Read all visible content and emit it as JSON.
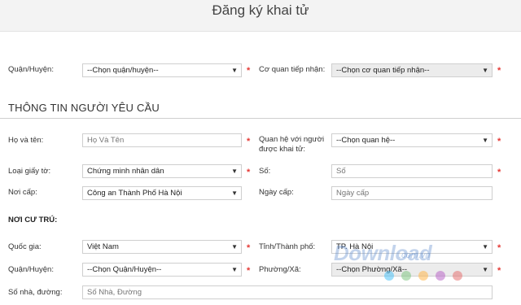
{
  "page": {
    "title": "Đăng ký khai tử"
  },
  "top": {
    "district_label": "Quận/Huyện:",
    "district_value": "--Chọn quận/huyện--",
    "agency_label": "Cơ quan tiếp nhận:",
    "agency_value": "--Chọn cơ quan tiếp nhận--"
  },
  "section": {
    "title": "THÔNG TIN NGƯỜI YÊU CẦU"
  },
  "requester": {
    "name_label": "Họ và tên:",
    "name_placeholder": "Họ Và Tên",
    "relation_label_1": "Quan hệ với người",
    "relation_label_2": "được khai tử:",
    "relation_value": "--Chọn quan hệ--",
    "doc_type_label": "Loại giấy tờ:",
    "doc_type_value": "Chứng minh nhân dân",
    "number_label": "Số:",
    "number_placeholder": "Số",
    "issued_by_label": "Nơi cấp:",
    "issued_by_value": "Công an Thành Phố Hà Nội",
    "issue_date_label": "Ngày cấp:",
    "issue_date_placeholder": "Ngày cấp"
  },
  "residence": {
    "heading": "NƠI CƯ TRÚ:",
    "country_label": "Quốc gia:",
    "country_value": "Việt Nam",
    "province_label": "Tỉnh/Thành phố:",
    "province_value": "TP. Hà Nội",
    "district_label": "Quận/Huyện:",
    "district_value": "--Chọn Quận/Huyện--",
    "ward_label": "Phường/Xã:",
    "ward_value": "--Chọn Phường/Xã--",
    "address_label": "Số nhà, đường:",
    "address_placeholder": "Số Nhà, Đường"
  },
  "watermark": {
    "text": "Download",
    "domain": ".com.vn"
  },
  "colors": {
    "required": "#e53935",
    "dots": [
      "#4fc3f7",
      "#81c784",
      "#ffb74d",
      "#ba68c8",
      "#e57373"
    ]
  }
}
